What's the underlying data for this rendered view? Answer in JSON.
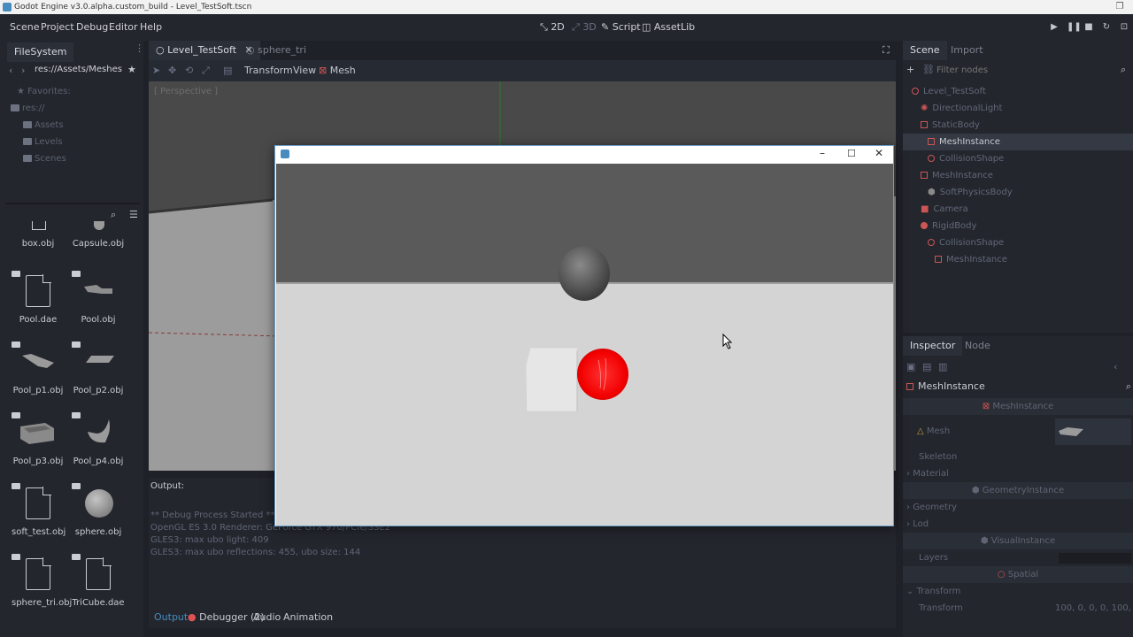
{
  "window": {
    "title": "Godot Engine v3.0.alpha.custom_build - Level_TestSoft.tscn"
  },
  "menubar": {
    "menus": [
      "Scene",
      "Project",
      "Debug",
      "Editor",
      "Help"
    ],
    "workspaces": [
      "2D",
      "3D",
      "Script",
      "AssetLib"
    ]
  },
  "filesystem": {
    "tab": "FileSystem",
    "path": "res://Assets/Meshes",
    "tree": [
      "Favorites:",
      "res://",
      "Assets",
      "Levels",
      "Scenes"
    ],
    "files": [
      {
        "name": "box.obj",
        "icon": "cube-thumb"
      },
      {
        "name": "Capsule.obj",
        "icon": "capsule-thumb"
      },
      {
        "name": "Pool.dae",
        "icon": "file-icon"
      },
      {
        "name": "Pool.obj",
        "icon": "pool-thumb"
      },
      {
        "name": "Pool_p1.obj",
        "icon": "slab-thumb"
      },
      {
        "name": "Pool_p2.obj",
        "icon": "slab-thumb"
      },
      {
        "name": "Pool_p3.obj",
        "icon": "box-thumb"
      },
      {
        "name": "Pool_p4.obj",
        "icon": "curve-thumb"
      },
      {
        "name": "soft_test.obj",
        "icon": "file-icon"
      },
      {
        "name": "sphere.obj",
        "icon": "sphere-thumb"
      },
      {
        "name": "sphere_tri.obj",
        "icon": "file-icon"
      },
      {
        "name": "TriCube.dae",
        "icon": "file-icon"
      }
    ]
  },
  "editor": {
    "tabs": [
      "Level_TestSoft",
      "sphere_tri"
    ],
    "toolbar": [
      "Transform",
      "View",
      "Mesh"
    ],
    "viewport_label": "[ Perspective ]"
  },
  "output": {
    "title": "Output:",
    "lines": [
      "** Debug Process Started **",
      "OpenGL ES 3.0 Renderer: GeForce GTX 970/PCIe/SSE2",
      "GLES3: max ubo light: 409",
      "GLES3: max ubo reflections: 455, ubo size: 144"
    ],
    "bottom_tabs": [
      "Output",
      "Debugger (2)",
      "Audio",
      "Animation"
    ]
  },
  "scene_dock": {
    "tabs": [
      "Scene",
      "Import"
    ],
    "filter_placeholder": "Filter nodes",
    "nodes": [
      {
        "name": "Level_TestSoft",
        "depth": 0
      },
      {
        "name": "DirectionalLight",
        "depth": 1
      },
      {
        "name": "StaticBody",
        "depth": 1
      },
      {
        "name": "MeshInstance",
        "depth": 2,
        "selected": true
      },
      {
        "name": "CollisionShape",
        "depth": 2
      },
      {
        "name": "MeshInstance",
        "depth": 1
      },
      {
        "name": "SoftPhysicsBody",
        "depth": 2
      },
      {
        "name": "Camera",
        "depth": 1
      },
      {
        "name": "RigidBody",
        "depth": 1
      },
      {
        "name": "CollisionShape",
        "depth": 2
      },
      {
        "name": "MeshInstance",
        "depth": 3
      }
    ]
  },
  "inspector": {
    "tabs": [
      "Inspector",
      "Node"
    ],
    "object": "MeshInstance",
    "rows": [
      {
        "type": "section",
        "label": "MeshInstance"
      },
      {
        "type": "prop",
        "label": "Mesh",
        "value": ""
      },
      {
        "type": "prop",
        "label": "Skeleton",
        "value": ""
      },
      {
        "type": "group",
        "label": "Material"
      },
      {
        "type": "section",
        "label": "GeometryInstance"
      },
      {
        "type": "group",
        "label": "Geometry"
      },
      {
        "type": "group",
        "label": "Lod"
      },
      {
        "type": "section",
        "label": "VisualInstance"
      },
      {
        "type": "prop",
        "label": "Layers",
        "value": ""
      },
      {
        "type": "section",
        "label": "Spatial"
      },
      {
        "type": "group",
        "label": "Transform"
      },
      {
        "type": "prop",
        "label": "Transform",
        "value": "100, 0, 0, 0, 100, 0,"
      }
    ]
  },
  "colors": {
    "accent": "#478cbf",
    "red_ball": "#ff0000",
    "selected": "#343944"
  }
}
